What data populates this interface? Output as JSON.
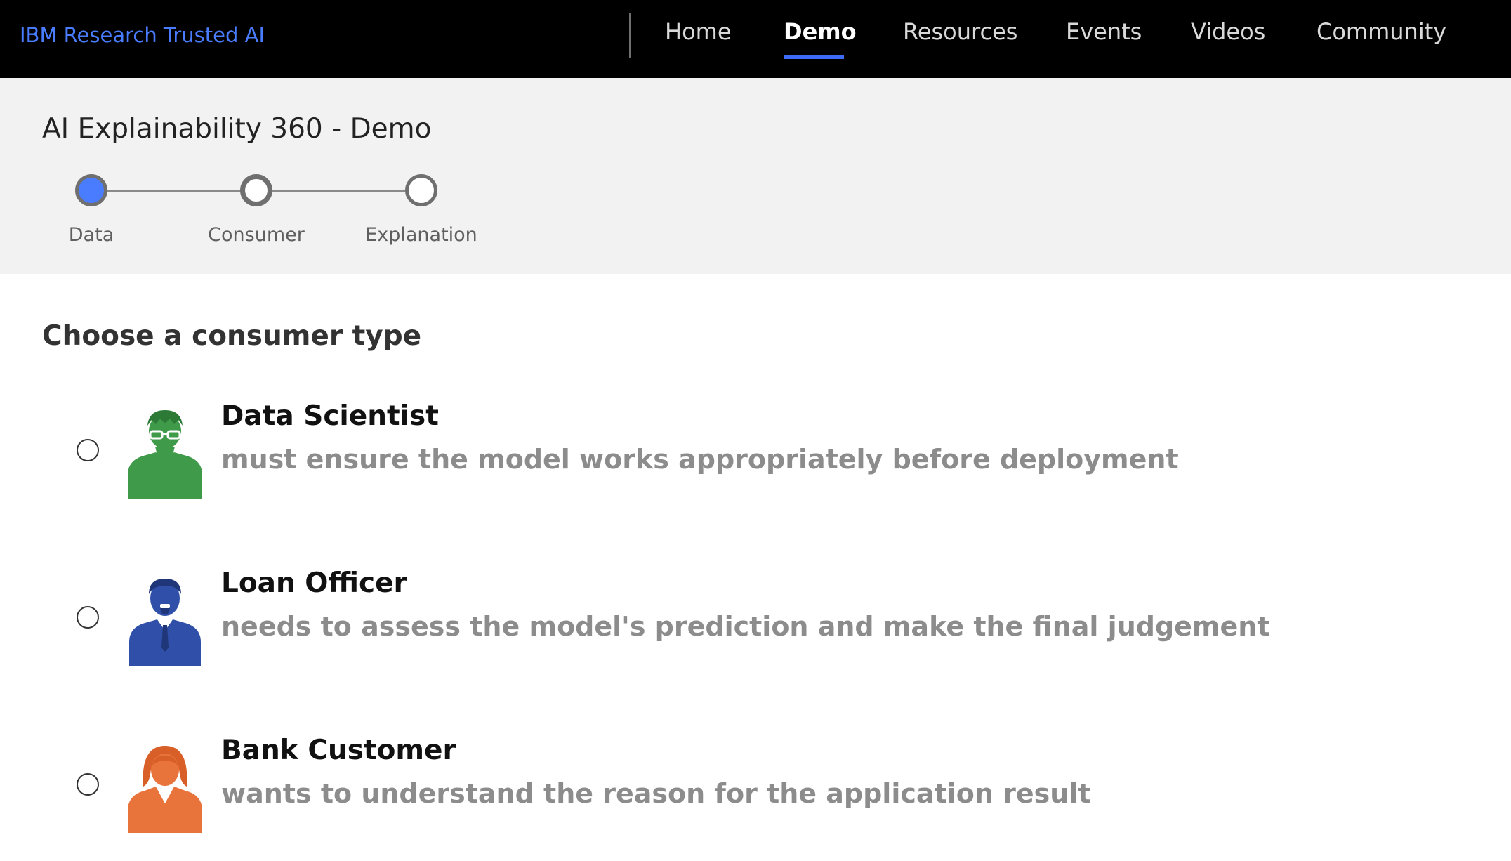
{
  "nav": {
    "brand": "IBM Research Trusted AI",
    "items": [
      {
        "label": "Home",
        "active": false
      },
      {
        "label": "Demo",
        "active": true
      },
      {
        "label": "Resources",
        "active": false
      },
      {
        "label": "Events",
        "active": false
      },
      {
        "label": "Videos",
        "active": false
      },
      {
        "label": "Community",
        "active": false
      }
    ],
    "colors": {
      "background": "#000000",
      "brand": "#4a7cff",
      "active_underline": "#3d6bf5"
    }
  },
  "page": {
    "title": "AI Explainability 360 - Demo"
  },
  "stepper": {
    "steps": [
      {
        "label": "Data",
        "state": "current"
      },
      {
        "label": "Consumer",
        "state": "next"
      },
      {
        "label": "Explanation",
        "state": "upcoming"
      }
    ],
    "colors": {
      "current": "#4a7cff",
      "ring": "#6f6f6f"
    }
  },
  "consumer": {
    "heading": "Choose a consumer type",
    "options": [
      {
        "title": "Data Scientist",
        "description": "must ensure the model works appropriately before deployment",
        "icon": "data-scientist-avatar-icon",
        "color": "#3f9a4a",
        "selected": false
      },
      {
        "title": "Loan Officer",
        "description": "needs to assess the model's prediction and make the final judgement",
        "icon": "loan-officer-avatar-icon",
        "color": "#2f4fa8",
        "selected": false
      },
      {
        "title": "Bank Customer",
        "description": "wants to understand the reason for the application result",
        "icon": "bank-customer-avatar-icon",
        "color": "#e8743c",
        "selected": false
      }
    ]
  }
}
